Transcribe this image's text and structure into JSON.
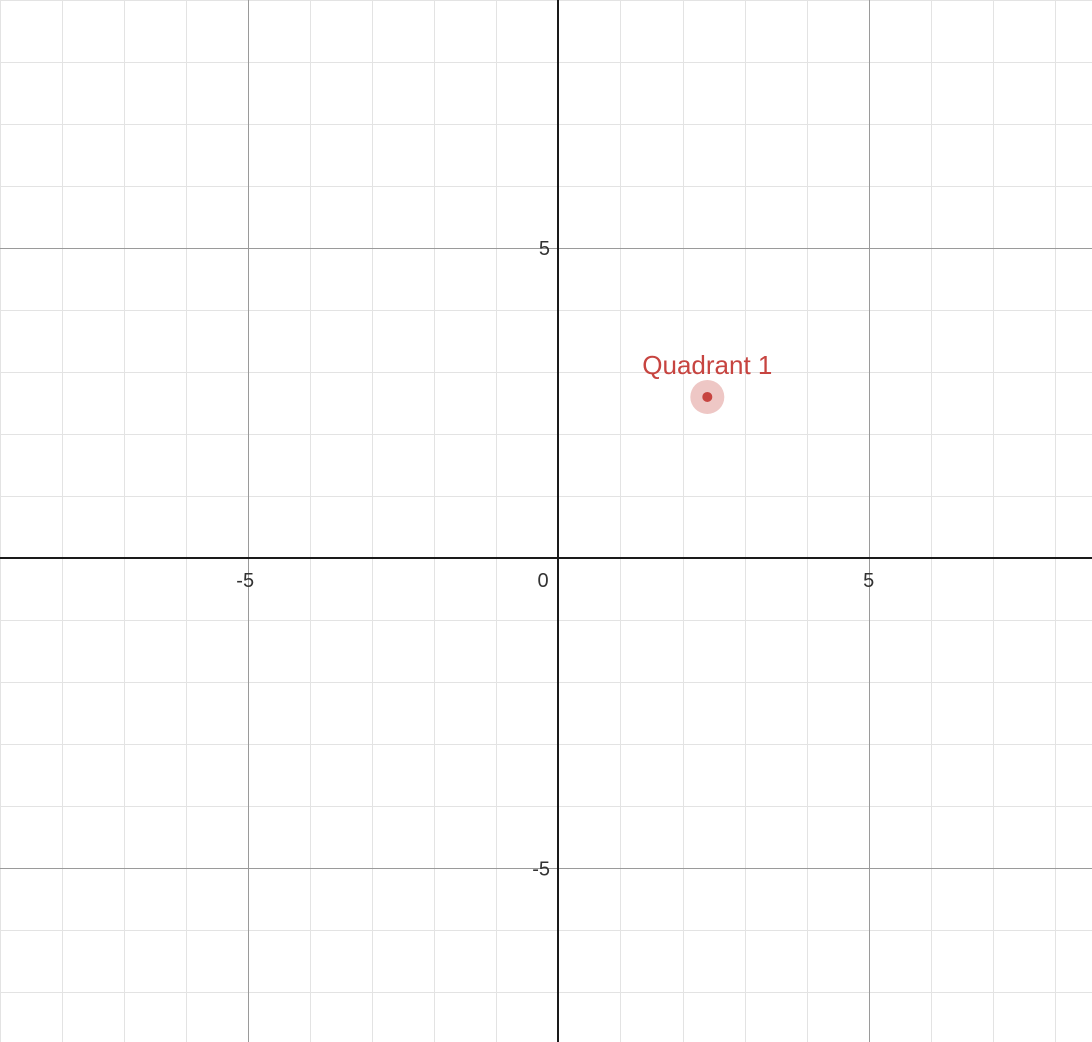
{
  "chart_data": {
    "type": "scatter",
    "xlim": [
      -9,
      8.6
    ],
    "ylim": [
      -7.8,
      9
    ],
    "grid": true,
    "minor_step": 1,
    "major_step": 5,
    "x_tick_labels": [
      {
        "value": -5,
        "label": "-5"
      },
      {
        "value": 5,
        "label": "5"
      }
    ],
    "y_tick_labels": [
      {
        "value": 5,
        "label": "5"
      },
      {
        "value": -5,
        "label": "-5"
      }
    ],
    "origin_label": "0",
    "points": [
      {
        "x": 2.4,
        "y": 2.6,
        "label": "Quadrant 1",
        "color": "#c74440"
      }
    ]
  },
  "colors": {
    "minor_grid": "#e3e3e3",
    "major_grid": "#9a9a9a",
    "axis": "#1a1a1a",
    "background": "#ffffff"
  }
}
